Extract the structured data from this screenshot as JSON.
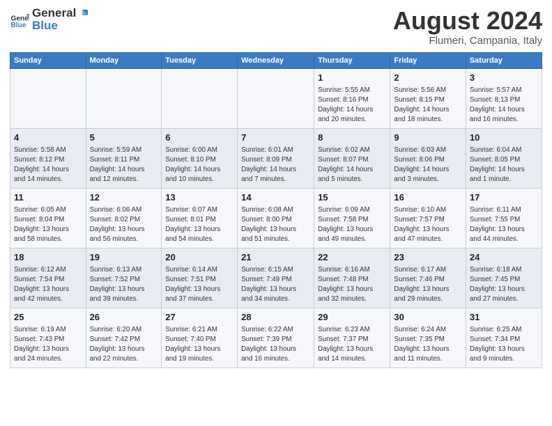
{
  "header": {
    "logo_general": "General",
    "logo_blue": "Blue",
    "main_title": "August 2024",
    "subtitle": "Flumeri, Campania, Italy"
  },
  "days_of_week": [
    "Sunday",
    "Monday",
    "Tuesday",
    "Wednesday",
    "Thursday",
    "Friday",
    "Saturday"
  ],
  "weeks": [
    [
      {
        "num": "",
        "info": ""
      },
      {
        "num": "",
        "info": ""
      },
      {
        "num": "",
        "info": ""
      },
      {
        "num": "",
        "info": ""
      },
      {
        "num": "1",
        "info": "Sunrise: 5:55 AM\nSunset: 8:16 PM\nDaylight: 14 hours\nand 20 minutes."
      },
      {
        "num": "2",
        "info": "Sunrise: 5:56 AM\nSunset: 8:15 PM\nDaylight: 14 hours\nand 18 minutes."
      },
      {
        "num": "3",
        "info": "Sunrise: 5:57 AM\nSunset: 8:13 PM\nDaylight: 14 hours\nand 16 minutes."
      }
    ],
    [
      {
        "num": "4",
        "info": "Sunrise: 5:58 AM\nSunset: 8:12 PM\nDaylight: 14 hours\nand 14 minutes."
      },
      {
        "num": "5",
        "info": "Sunrise: 5:59 AM\nSunset: 8:11 PM\nDaylight: 14 hours\nand 12 minutes."
      },
      {
        "num": "6",
        "info": "Sunrise: 6:00 AM\nSunset: 8:10 PM\nDaylight: 14 hours\nand 10 minutes."
      },
      {
        "num": "7",
        "info": "Sunrise: 6:01 AM\nSunset: 8:09 PM\nDaylight: 14 hours\nand 7 minutes."
      },
      {
        "num": "8",
        "info": "Sunrise: 6:02 AM\nSunset: 8:07 PM\nDaylight: 14 hours\nand 5 minutes."
      },
      {
        "num": "9",
        "info": "Sunrise: 6:03 AM\nSunset: 8:06 PM\nDaylight: 14 hours\nand 3 minutes."
      },
      {
        "num": "10",
        "info": "Sunrise: 6:04 AM\nSunset: 8:05 PM\nDaylight: 14 hours\nand 1 minute."
      }
    ],
    [
      {
        "num": "11",
        "info": "Sunrise: 6:05 AM\nSunset: 8:04 PM\nDaylight: 13 hours\nand 58 minutes."
      },
      {
        "num": "12",
        "info": "Sunrise: 6:06 AM\nSunset: 8:02 PM\nDaylight: 13 hours\nand 56 minutes."
      },
      {
        "num": "13",
        "info": "Sunrise: 6:07 AM\nSunset: 8:01 PM\nDaylight: 13 hours\nand 54 minutes."
      },
      {
        "num": "14",
        "info": "Sunrise: 6:08 AM\nSunset: 8:00 PM\nDaylight: 13 hours\nand 51 minutes."
      },
      {
        "num": "15",
        "info": "Sunrise: 6:09 AM\nSunset: 7:58 PM\nDaylight: 13 hours\nand 49 minutes."
      },
      {
        "num": "16",
        "info": "Sunrise: 6:10 AM\nSunset: 7:57 PM\nDaylight: 13 hours\nand 47 minutes."
      },
      {
        "num": "17",
        "info": "Sunrise: 6:11 AM\nSunset: 7:55 PM\nDaylight: 13 hours\nand 44 minutes."
      }
    ],
    [
      {
        "num": "18",
        "info": "Sunrise: 6:12 AM\nSunset: 7:54 PM\nDaylight: 13 hours\nand 42 minutes."
      },
      {
        "num": "19",
        "info": "Sunrise: 6:13 AM\nSunset: 7:52 PM\nDaylight: 13 hours\nand 39 minutes."
      },
      {
        "num": "20",
        "info": "Sunrise: 6:14 AM\nSunset: 7:51 PM\nDaylight: 13 hours\nand 37 minutes."
      },
      {
        "num": "21",
        "info": "Sunrise: 6:15 AM\nSunset: 7:49 PM\nDaylight: 13 hours\nand 34 minutes."
      },
      {
        "num": "22",
        "info": "Sunrise: 6:16 AM\nSunset: 7:48 PM\nDaylight: 13 hours\nand 32 minutes."
      },
      {
        "num": "23",
        "info": "Sunrise: 6:17 AM\nSunset: 7:46 PM\nDaylight: 13 hours\nand 29 minutes."
      },
      {
        "num": "24",
        "info": "Sunrise: 6:18 AM\nSunset: 7:45 PM\nDaylight: 13 hours\nand 27 minutes."
      }
    ],
    [
      {
        "num": "25",
        "info": "Sunrise: 6:19 AM\nSunset: 7:43 PM\nDaylight: 13 hours\nand 24 minutes."
      },
      {
        "num": "26",
        "info": "Sunrise: 6:20 AM\nSunset: 7:42 PM\nDaylight: 13 hours\nand 22 minutes."
      },
      {
        "num": "27",
        "info": "Sunrise: 6:21 AM\nSunset: 7:40 PM\nDaylight: 13 hours\nand 19 minutes."
      },
      {
        "num": "28",
        "info": "Sunrise: 6:22 AM\nSunset: 7:39 PM\nDaylight: 13 hours\nand 16 minutes."
      },
      {
        "num": "29",
        "info": "Sunrise: 6:23 AM\nSunset: 7:37 PM\nDaylight: 13 hours\nand 14 minutes."
      },
      {
        "num": "30",
        "info": "Sunrise: 6:24 AM\nSunset: 7:35 PM\nDaylight: 13 hours\nand 11 minutes."
      },
      {
        "num": "31",
        "info": "Sunrise: 6:25 AM\nSunset: 7:34 PM\nDaylight: 13 hours\nand 9 minutes."
      }
    ]
  ]
}
